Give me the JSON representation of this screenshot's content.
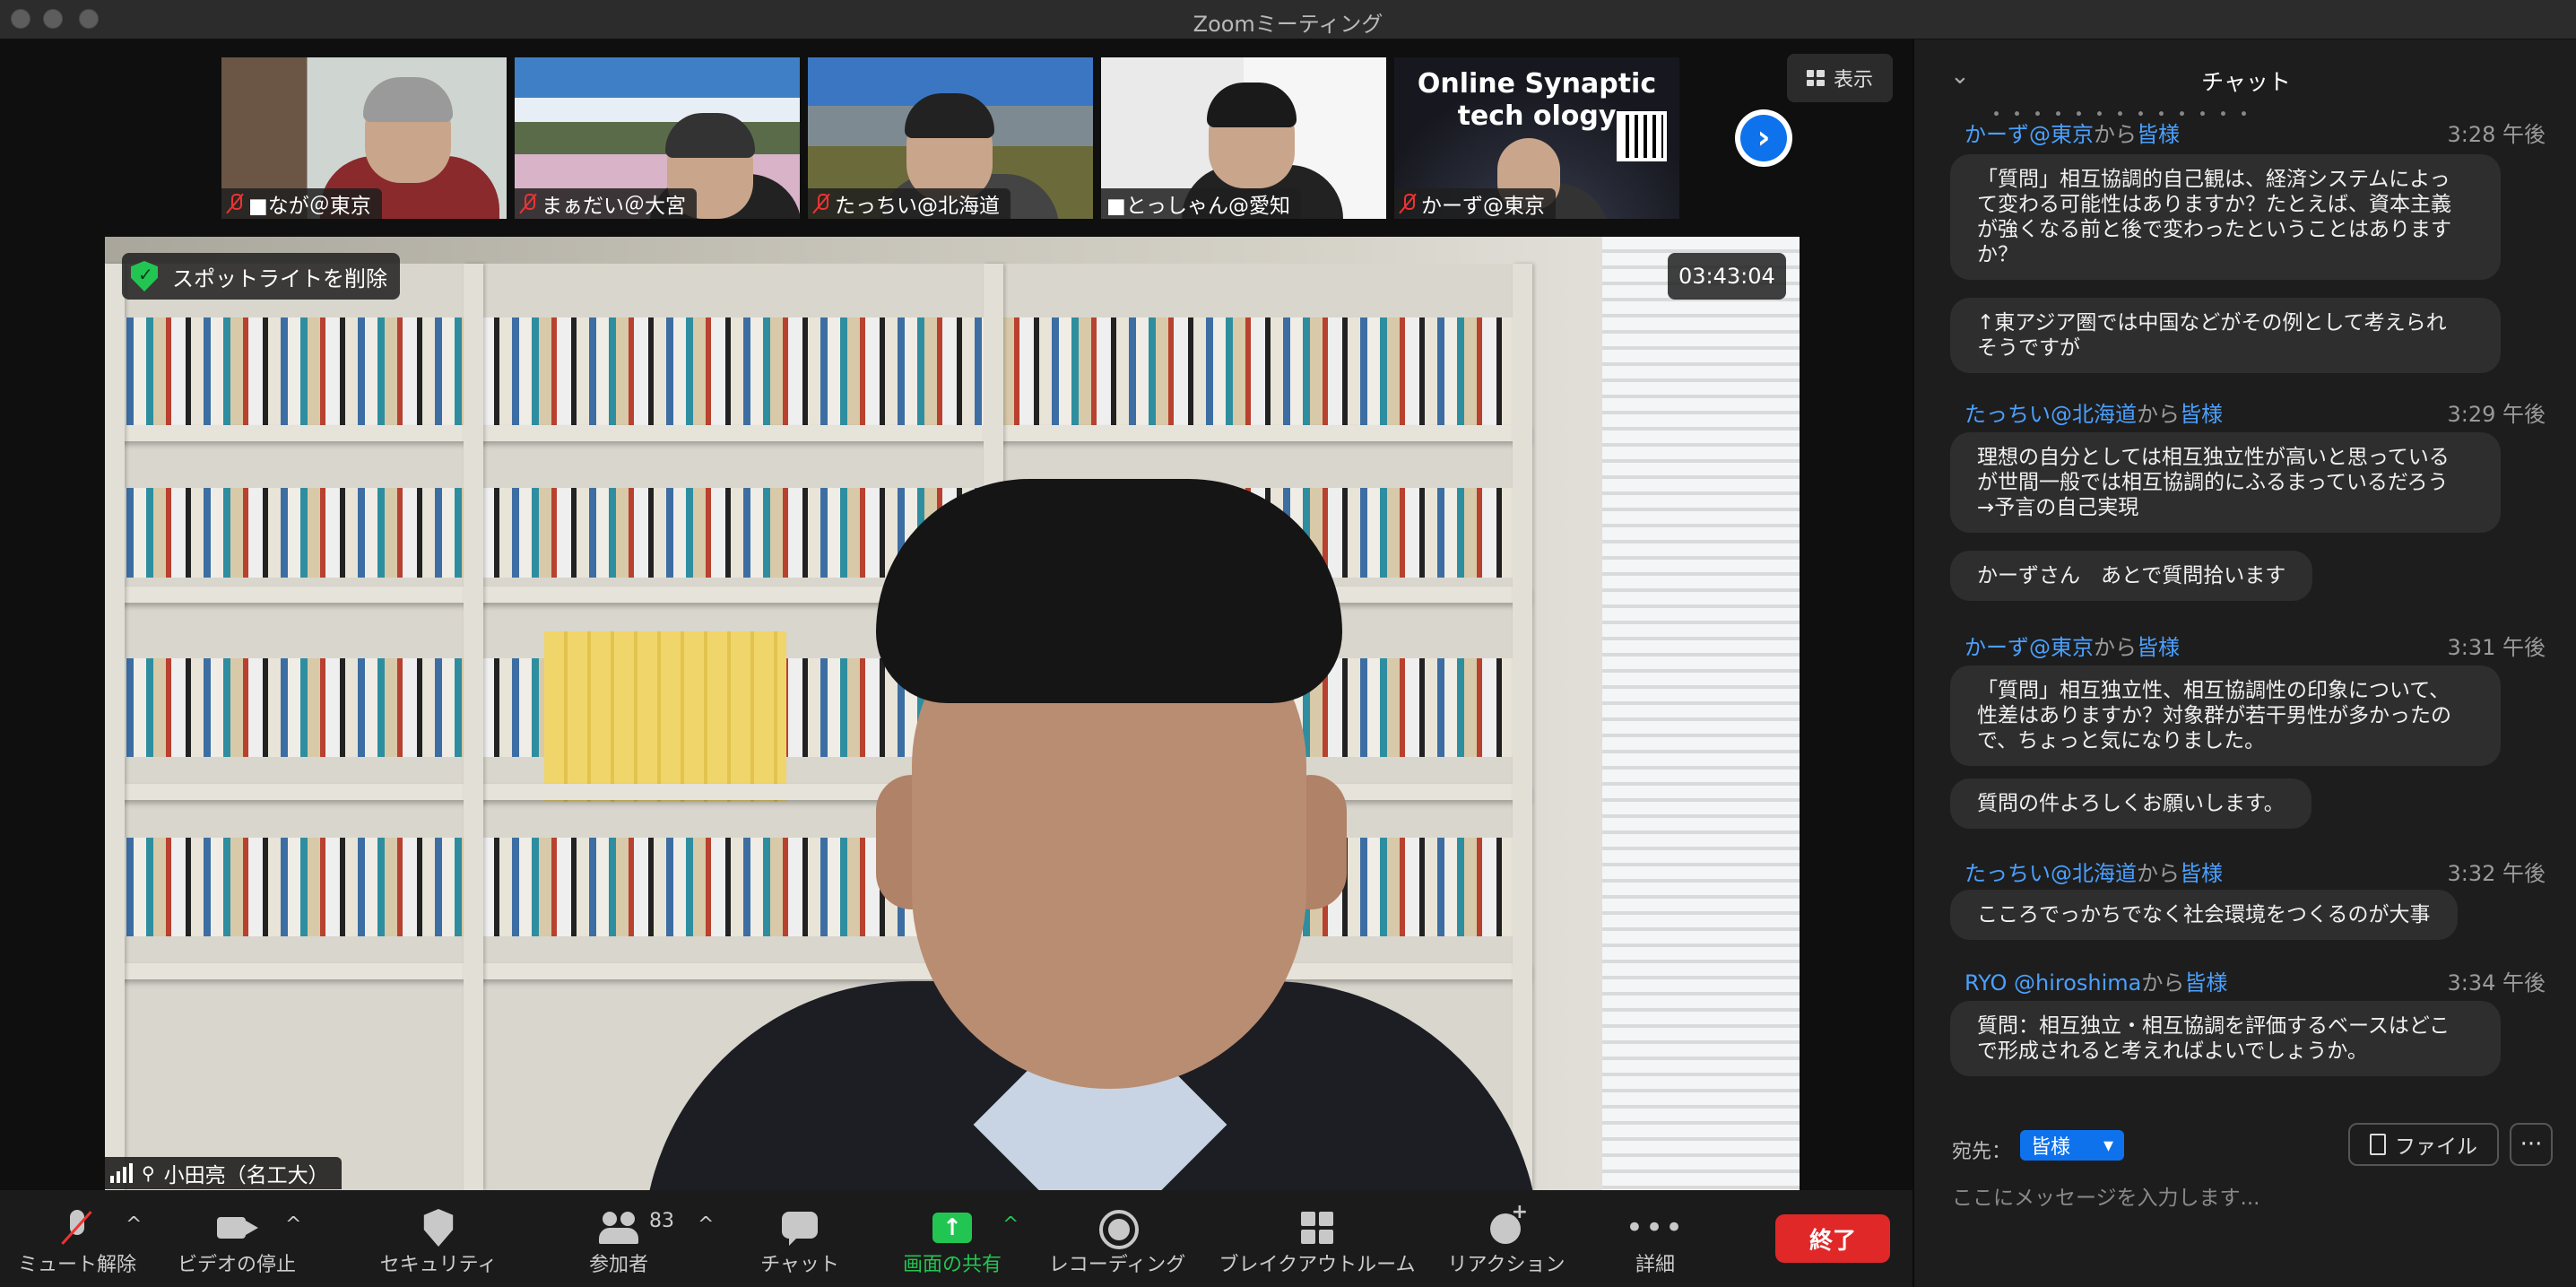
{
  "window": {
    "title": "Zoomミーティング"
  },
  "thumbnails": [
    {
      "name": "■なが＠東京",
      "muted": true
    },
    {
      "name": "まぁだい＠大宮",
      "muted": true
    },
    {
      "name": "たっちい@北海道",
      "muted": true
    },
    {
      "name": "■とっしゃん@愛知",
      "muted": false
    },
    {
      "name": "かーず@東京",
      "muted": true,
      "overlay_line1": "Online Synaptic",
      "overlay_line2": "tech ology"
    }
  ],
  "view_button": {
    "label": "表示"
  },
  "next_page_icon": "chevron-right-icon",
  "main_video": {
    "spotlight_label": "スポットライトを削除",
    "timer": "03:43:04",
    "speaker_name": "小田亮（名工大）"
  },
  "toolbar": {
    "mute": "ミュート解除",
    "video": "ビデオの停止",
    "security": "セキュリティ",
    "participants": "参加者",
    "participants_count": "83",
    "chat": "チャット",
    "share": "画面の共有",
    "recording": "レコーディング",
    "breakout": "ブレイクアウトルーム",
    "reaction": "リアクション",
    "more": "詳細",
    "end": "終了",
    "caret": "^"
  },
  "chat": {
    "title": "チャット",
    "collapse": "⌄",
    "cut_off_top": "・・・・・・・・・・・・・",
    "messages": [
      {
        "from": "かーず@東京",
        "mid": "から",
        "to": "皆様",
        "time": "3:28 午後",
        "bubbles": [
          [
            "「質問」相互協調的自己観は、経済システムによっ",
            "て変わる可能性はありますか？たとえば、資本主義",
            "が強くなる前と後で変わったということはあります",
            "か？"
          ],
          [
            "↑東アジア圏では中国などがその例として考えられ",
            "そうですが"
          ]
        ]
      },
      {
        "from": "たっちい@北海道",
        "mid": "から",
        "to": "皆様",
        "time": "3:29 午後",
        "bubbles": [
          [
            "理想の自分としては相互独立性が高いと思っている",
            "が世間一般では相互協調的にふるまっているだろう",
            "→予言の自己実現"
          ],
          [
            "かーずさん　あとで質問拾います"
          ]
        ]
      },
      {
        "from": "かーず@東京",
        "mid": "から",
        "to": "皆様",
        "time": "3:31 午後",
        "bubbles": [
          [
            "「質問」相互独立性、相互協調性の印象について、",
            "性差はありますか？対象群が若干男性が多かったの",
            "で、ちょっと気になりました。"
          ],
          [
            "質問の件よろしくお願いします。"
          ]
        ]
      },
      {
        "from": "たっちい@北海道",
        "mid": "から",
        "to": "皆様",
        "time": "3:32 午後",
        "bubbles": [
          [
            "こころでっかちでなく社会環境をつくるのが大事"
          ]
        ]
      },
      {
        "from": "RYO @hiroshima",
        "mid": "から",
        "to": "皆様",
        "time": "3:34 午後",
        "bubbles": [
          [
            "質問：相互独立・相互協調を評価するベースはどこ",
            "で形成されると考えればよいでしょうか。"
          ]
        ]
      }
    ],
    "compose": {
      "to_label": "宛先：",
      "to_value": "皆様",
      "file_label": "ファイル",
      "more": "···",
      "placeholder": "ここにメッセージを入力します..."
    }
  },
  "colors": {
    "accent": "#0e72ed",
    "share_green": "#23c552",
    "end_red": "#e02828",
    "sender_blue": "#4aa0ff"
  }
}
